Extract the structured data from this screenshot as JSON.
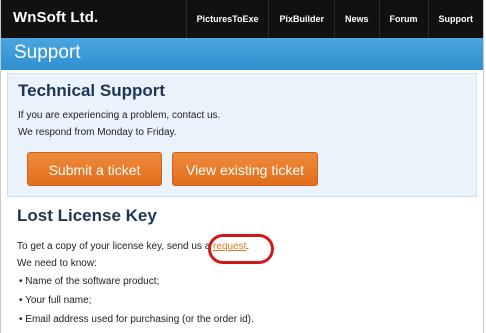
{
  "topbar": {
    "brand": "WnSoft Ltd.",
    "nav": [
      "PicturesToExe",
      "PixBuilder",
      "News",
      "Forum",
      "Support"
    ]
  },
  "section": {
    "title": "Support"
  },
  "technical": {
    "title": "Technical Support",
    "line1": "If you are experiencing a problem, contact us.",
    "line2": "We respond from Monday to Friday.",
    "btn_submit": "Submit a ticket",
    "btn_view": "View existing ticket"
  },
  "lost": {
    "title": "Lost License Key",
    "text_before": "To get a copy of your license key, send us a",
    "link_text": "request",
    "text_after": ".",
    "need": "We need to know:",
    "bullets": [
      "Name of the software product;",
      "Your full name;",
      "Email address used for purchasing (or the order id)."
    ]
  },
  "colors": {
    "topbar_bg": "#111111",
    "section_bar": "#3b9ad8",
    "panel_bg": "#eaf3fb",
    "button_orange": "#e87a2b",
    "highlight_red": "#d01a1a"
  }
}
